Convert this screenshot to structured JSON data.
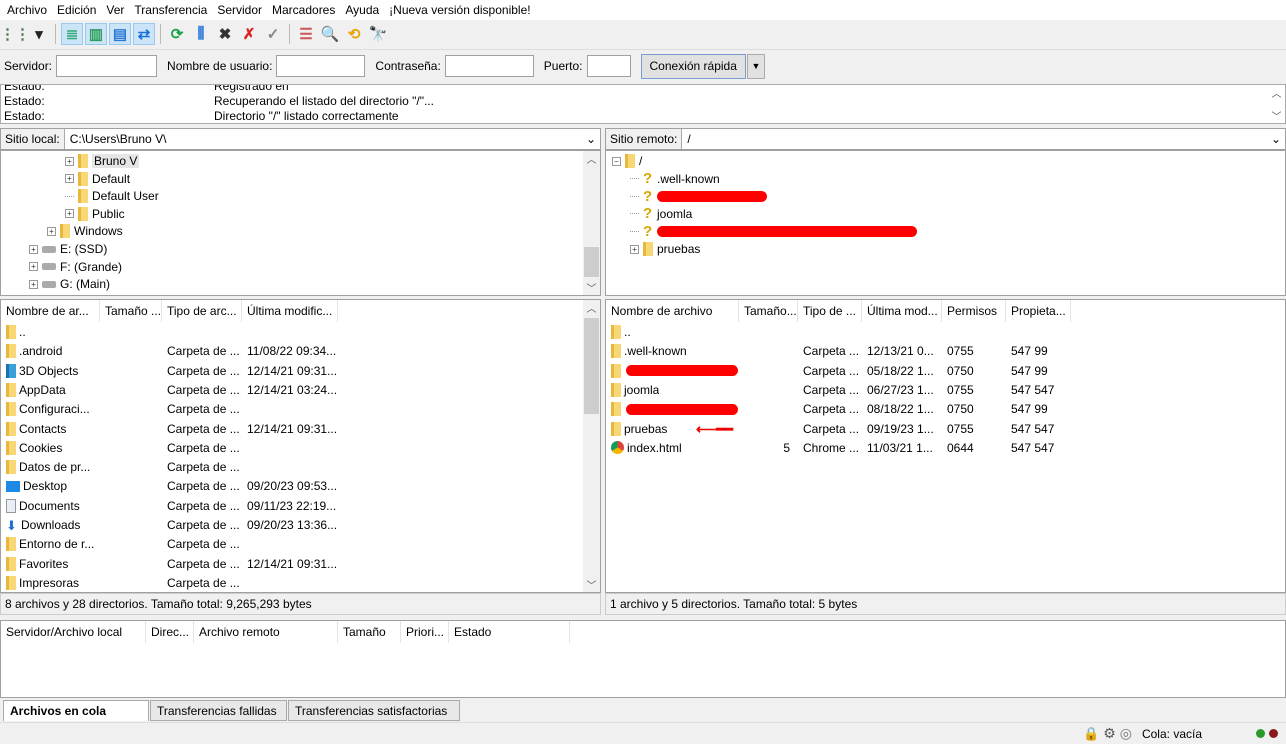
{
  "menu": [
    "Archivo",
    "Edición",
    "Ver",
    "Transferencia",
    "Servidor",
    "Marcadores",
    "Ayuda",
    "¡Nueva versión disponible!"
  ],
  "toolbar": [
    {
      "icon": "site-manager-icon",
      "glyph": "⋮⋮",
      "color": "#4a7a4a"
    },
    {
      "icon": "dropdown-arrow-icon",
      "glyph": "▾",
      "color": "#222"
    },
    {
      "sep": true
    },
    {
      "icon": "toggle-log-icon",
      "glyph": "≣",
      "color": "#3a7",
      "active": true
    },
    {
      "icon": "toggle-local-tree-icon",
      "glyph": "▥",
      "color": "#2a9d5a",
      "active": true
    },
    {
      "icon": "toggle-remote-tree-icon",
      "glyph": "▤",
      "color": "#2a7ad5",
      "active": true
    },
    {
      "icon": "toggle-queue-icon",
      "glyph": "⇄",
      "color": "#1a6fd8",
      "active": true
    },
    {
      "sep": true
    },
    {
      "icon": "refresh-icon",
      "glyph": "⟳",
      "color": "#1aa34a"
    },
    {
      "icon": "filter-icon",
      "glyph": "⫼",
      "color": "#1a6fd8"
    },
    {
      "icon": "cancel-icon",
      "glyph": "✖",
      "color": "#333"
    },
    {
      "icon": "disconnect-icon",
      "glyph": "✗",
      "color": "#d22"
    },
    {
      "icon": "reconnect-icon",
      "glyph": "✓",
      "color": "#888"
    },
    {
      "sep": true
    },
    {
      "icon": "directory-comparison-icon",
      "glyph": "☰",
      "color": "#c55"
    },
    {
      "icon": "search-files-icon",
      "glyph": "🔍",
      "color": "#555"
    },
    {
      "icon": "sync-browsing-icon",
      "glyph": "⟲",
      "color": "#e9a400"
    },
    {
      "icon": "find-binoculars-icon",
      "glyph": "🔭",
      "color": "#333"
    }
  ],
  "quickconnect": {
    "server_label": "Servidor:",
    "server_value": "",
    "user_label": "Nombre de usuario:",
    "user_value": "",
    "pass_label": "Contraseña:",
    "pass_value": "",
    "port_label": "Puerto:",
    "port_value": "",
    "connect_label": "Conexión rápida"
  },
  "log": [
    {
      "type": "Estado:",
      "msg": "Registrado en"
    },
    {
      "type": "Estado:",
      "msg": "Recuperando el listado del directorio \"/\"..."
    },
    {
      "type": "Estado:",
      "msg": "Directorio \"/\" listado correctamente"
    }
  ],
  "local": {
    "label": "Sitio local:",
    "path": "C:\\Users\\Bruno V\\",
    "tree": [
      {
        "name": "Bruno V",
        "indent": 3,
        "expander": "+",
        "icon": "user-folder",
        "selected": true
      },
      {
        "name": "Default",
        "indent": 3,
        "expander": "+",
        "icon": "folder"
      },
      {
        "name": "Default User",
        "indent": 3,
        "expander": "",
        "icon": "folder"
      },
      {
        "name": "Public",
        "indent": 3,
        "expander": "+",
        "icon": "folder"
      },
      {
        "name": "Windows",
        "indent": 2,
        "expander": "+",
        "icon": "folder"
      },
      {
        "name": "E: (SSD)",
        "indent": 1,
        "expander": "+",
        "icon": "drive"
      },
      {
        "name": "F: (Grande)",
        "indent": 1,
        "expander": "+",
        "icon": "drive"
      },
      {
        "name": "G: (Main)",
        "indent": 1,
        "expander": "+",
        "icon": "drive"
      }
    ],
    "columns": [
      "Nombre de ar...",
      "Tamaño ...",
      "Tipo de arc...",
      "Última modific..."
    ],
    "files": [
      {
        "name": "..",
        "size": "",
        "type": "",
        "modified": "",
        "icon": "folder"
      },
      {
        "name": ".android",
        "size": "",
        "type": "Carpeta de ...",
        "modified": "11/08/22 09:34...",
        "icon": "folder"
      },
      {
        "name": "3D Objects",
        "size": "",
        "type": "Carpeta de ...",
        "modified": "12/14/21 09:31...",
        "icon": "3d-objects"
      },
      {
        "name": "AppData",
        "size": "",
        "type": "Carpeta de ...",
        "modified": "12/14/21 03:24...",
        "icon": "folder"
      },
      {
        "name": "Configuraci...",
        "size": "",
        "type": "Carpeta de ...",
        "modified": "",
        "icon": "folder"
      },
      {
        "name": "Contacts",
        "size": "",
        "type": "Carpeta de ...",
        "modified": "12/14/21 09:31...",
        "icon": "contacts"
      },
      {
        "name": "Cookies",
        "size": "",
        "type": "Carpeta de ...",
        "modified": "",
        "icon": "folder"
      },
      {
        "name": "Datos de pr...",
        "size": "",
        "type": "Carpeta de ...",
        "modified": "",
        "icon": "folder"
      },
      {
        "name": "Desktop",
        "size": "",
        "type": "Carpeta de ...",
        "modified": "09/20/23 09:53...",
        "icon": "desktop"
      },
      {
        "name": "Documents",
        "size": "",
        "type": "Carpeta de ...",
        "modified": "09/11/23 22:19...",
        "icon": "documents"
      },
      {
        "name": "Downloads",
        "size": "",
        "type": "Carpeta de ...",
        "modified": "09/20/23 13:36...",
        "icon": "downloads"
      },
      {
        "name": "Entorno de r...",
        "size": "",
        "type": "Carpeta de ...",
        "modified": "",
        "icon": "folder"
      },
      {
        "name": "Favorites",
        "size": "",
        "type": "Carpeta de ...",
        "modified": "12/14/21 09:31...",
        "icon": "favorites"
      },
      {
        "name": "Impresoras",
        "size": "",
        "type": "Carpeta de ...",
        "modified": "",
        "icon": "folder"
      }
    ],
    "status": "8 archivos y 28 directorios. Tamaño total: 9,265,293 bytes"
  },
  "remote": {
    "label": "Sitio remoto:",
    "path": "/",
    "tree": [
      {
        "name": "/",
        "indent": 0,
        "expander": "−",
        "icon": "folder"
      },
      {
        "name": ".well-known",
        "indent": 1,
        "expander": "",
        "icon": "unknown"
      },
      {
        "name": "",
        "indent": 1,
        "expander": "",
        "icon": "unknown",
        "redacted": true,
        "redact_width": 110
      },
      {
        "name": "joomla",
        "indent": 1,
        "expander": "",
        "icon": "unknown"
      },
      {
        "name": "",
        "indent": 1,
        "expander": "",
        "icon": "unknown",
        "redacted": true,
        "redact_width": 260
      },
      {
        "name": "pruebas",
        "indent": 1,
        "expander": "+",
        "icon": "folder"
      }
    ],
    "columns": [
      "Nombre de archivo",
      "Tamaño...",
      "Tipo de ...",
      "Última mod...",
      "Permisos",
      "Propieta..."
    ],
    "files": [
      {
        "name": "..",
        "size": "",
        "type": "",
        "modified": "",
        "perms": "",
        "owner": "",
        "icon": "folder"
      },
      {
        "name": ".well-known",
        "size": "",
        "type": "Carpeta ...",
        "modified": "12/13/21 0...",
        "perms": "0755",
        "owner": "547 99",
        "icon": "folder"
      },
      {
        "name": "",
        "redacted": true,
        "size": "",
        "type": "Carpeta ...",
        "modified": "05/18/22 1...",
        "perms": "0750",
        "owner": "547 99",
        "icon": "folder"
      },
      {
        "name": "joomla",
        "size": "",
        "type": "Carpeta ...",
        "modified": "06/27/23 1...",
        "perms": "0755",
        "owner": "547 547",
        "icon": "folder"
      },
      {
        "name": "",
        "redacted": true,
        "size": "",
        "type": "Carpeta ...",
        "modified": "08/18/22 1...",
        "perms": "0750",
        "owner": "547 99",
        "icon": "folder"
      },
      {
        "name": "pruebas",
        "size": "",
        "type": "Carpeta ...",
        "modified": "09/19/23 1...",
        "perms": "0755",
        "owner": "547 547",
        "icon": "folder",
        "annotated_arrow": true
      },
      {
        "name": "index.html",
        "size": "5",
        "type": "Chrome ...",
        "modified": "11/03/21 1...",
        "perms": "0644",
        "owner": "547 547",
        "icon": "chrome"
      }
    ],
    "status": "1 archivo y 5 directorios. Tamaño total: 5 bytes"
  },
  "queue": {
    "columns": [
      "Servidor/Archivo local",
      "Direc...",
      "Archivo remoto",
      "Tamaño",
      "Priori...",
      "Estado"
    ],
    "tabs": [
      "Archivos en cola",
      "Transferencias fallidas",
      "Transferencias satisfactorias"
    ],
    "active_tab": 0
  },
  "statusbar": {
    "queue_text": "Cola: vacía",
    "icons": [
      "lock-icon",
      "gear-icon",
      "speed-limit-icon"
    ],
    "leds": {
      "receive": "#2a9a2a",
      "send": "#8a1a1a"
    }
  }
}
